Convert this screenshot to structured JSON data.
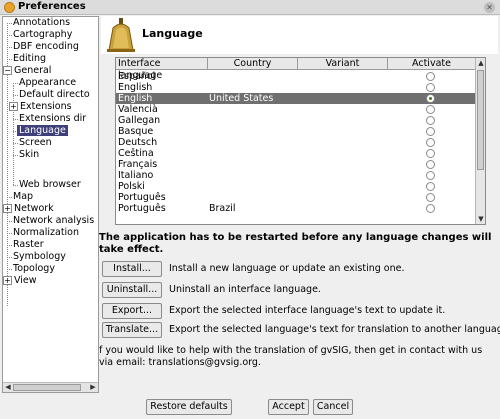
{
  "window": {
    "title": "Preferences"
  },
  "tree": {
    "items": [
      {
        "label": "Annotations"
      },
      {
        "label": "Cartography"
      },
      {
        "label": "DBF encoding"
      },
      {
        "label": "Editing"
      },
      {
        "label": "General"
      },
      {
        "label": "Appearance"
      },
      {
        "label": "Default directo"
      },
      {
        "label": "Extensions"
      },
      {
        "label": "Extensions dir"
      },
      {
        "label": "Language"
      },
      {
        "label": "Screen"
      },
      {
        "label": "Skin"
      },
      {
        "label": "Web browser"
      },
      {
        "label": "Map"
      },
      {
        "label": "Network"
      },
      {
        "label": "Network analysis"
      },
      {
        "label": "Normalization"
      },
      {
        "label": "Raster"
      },
      {
        "label": "Symbology"
      },
      {
        "label": "Topology"
      },
      {
        "label": "View"
      }
    ]
  },
  "header": {
    "title": "Language"
  },
  "table": {
    "columns": [
      "Interface language",
      "Country",
      "Variant",
      "Activate"
    ],
    "rows": [
      {
        "language": "Español",
        "country": "",
        "variant": "",
        "active": false
      },
      {
        "language": "English",
        "country": "",
        "variant": "",
        "active": false
      },
      {
        "language": "English",
        "country": "United States",
        "variant": "",
        "active": true
      },
      {
        "language": "Valencià",
        "country": "",
        "variant": "",
        "active": false
      },
      {
        "language": "Gallegan",
        "country": "",
        "variant": "",
        "active": false
      },
      {
        "language": "Basque",
        "country": "",
        "variant": "",
        "active": false
      },
      {
        "language": "Deutsch",
        "country": "",
        "variant": "",
        "active": false
      },
      {
        "language": "Čeština",
        "country": "",
        "variant": "",
        "active": false
      },
      {
        "language": "Français",
        "country": "",
        "variant": "",
        "active": false
      },
      {
        "language": "Italiano",
        "country": "",
        "variant": "",
        "active": false
      },
      {
        "language": "Polski",
        "country": "",
        "variant": "",
        "active": false
      },
      {
        "language": "Português",
        "country": "",
        "variant": "",
        "active": false
      },
      {
        "language": "Português",
        "country": "Brazil",
        "variant": "",
        "active": false
      }
    ]
  },
  "notice": "The application has to be restarted before any language changes will take effect.",
  "actions": [
    {
      "button": "Install...",
      "description": "Install a new language or update an existing one."
    },
    {
      "button": "Uninstall...",
      "description": "Uninstall an interface language."
    },
    {
      "button": "Export...",
      "description": "Export the selected interface language's text to update it."
    },
    {
      "button": "Translate...",
      "description": "Export the selected language's text for translation to another language."
    }
  ],
  "help": "f you would like to help with the translation of gvSIG, then get in contact with us via email: translations@gvsig.org.",
  "footer": {
    "restore": "Restore defaults",
    "accept": "Accept",
    "cancel": "Cancel"
  }
}
